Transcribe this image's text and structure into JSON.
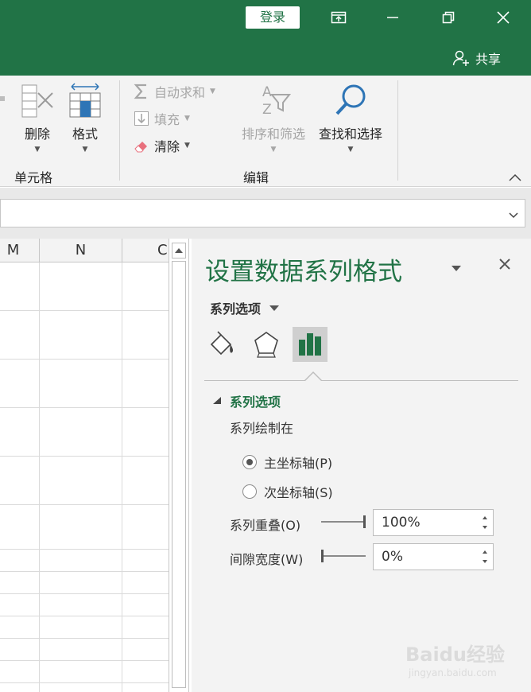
{
  "titlebar": {
    "login_label": "登录",
    "share_label": "共享"
  },
  "ribbon": {
    "cells_group": {
      "delete_label": "删除",
      "format_label": "格式",
      "group_label": "单元格"
    },
    "editing_group": {
      "autosum_label": "自动求和",
      "fill_label": "填充",
      "clear_label": "清除",
      "sort_filter_label": "排序和筛选",
      "find_select_label": "查找和选择",
      "group_label": "编辑"
    }
  },
  "sheet": {
    "columns": [
      "M",
      "N",
      "C"
    ]
  },
  "pane": {
    "title": "设置数据系列格式",
    "dropdown_label": "系列选项",
    "section_header": "系列选项",
    "plot_on_label": "系列绘制在",
    "primary_axis_label": "主坐标轴(P)",
    "secondary_axis_label": "次坐标轴(S)",
    "selected_axis": "primary",
    "overlap_label": "系列重叠(O)",
    "overlap_value": "100%",
    "gap_label": "间隙宽度(W)",
    "gap_value": "0%"
  },
  "colors": {
    "accent": "#217346",
    "ribbon_bg": "#f3f3f3",
    "selected_tab": "#cfcfcf"
  },
  "watermark": {
    "text": "Baidu经验",
    "sub": "jingyan.baidu.com"
  }
}
